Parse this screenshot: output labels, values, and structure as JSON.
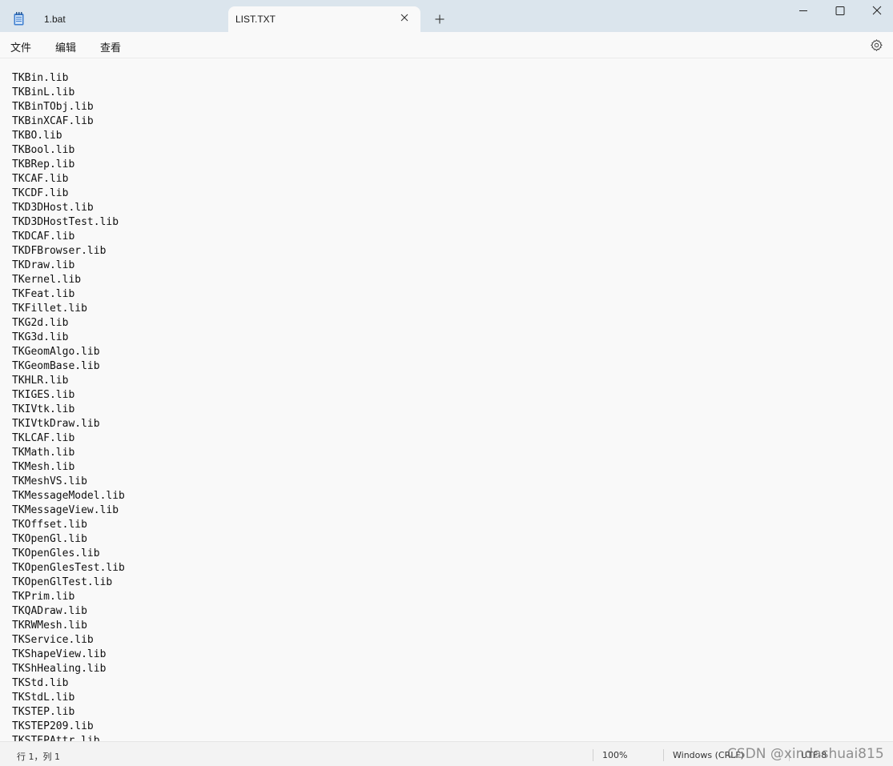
{
  "app": {
    "icon": "notepad-icon"
  },
  "tabs": [
    {
      "label": "1.bat",
      "active": false
    },
    {
      "label": "LIST.TXT",
      "active": true
    }
  ],
  "window_controls": {
    "minimize": "minimize-icon",
    "maximize": "maximize-icon",
    "close": "close-icon"
  },
  "menu": {
    "file": "文件",
    "edit": "编辑",
    "view": "查看",
    "settings_icon": "gear-icon"
  },
  "editor": {
    "lines": [
      "TKBin.lib",
      "TKBinL.lib",
      "TKBinTObj.lib",
      "TKBinXCAF.lib",
      "TKBO.lib",
      "TKBool.lib",
      "TKBRep.lib",
      "TKCAF.lib",
      "TKCDF.lib",
      "TKD3DHost.lib",
      "TKD3DHostTest.lib",
      "TKDCAF.lib",
      "TKDFBrowser.lib",
      "TKDraw.lib",
      "TKernel.lib",
      "TKFeat.lib",
      "TKFillet.lib",
      "TKG2d.lib",
      "TKG3d.lib",
      "TKGeomAlgo.lib",
      "TKGeomBase.lib",
      "TKHLR.lib",
      "TKIGES.lib",
      "TKIVtk.lib",
      "TKIVtkDraw.lib",
      "TKLCAF.lib",
      "TKMath.lib",
      "TKMesh.lib",
      "TKMeshVS.lib",
      "TKMessageModel.lib",
      "TKMessageView.lib",
      "TKOffset.lib",
      "TKOpenGl.lib",
      "TKOpenGles.lib",
      "TKOpenGlesTest.lib",
      "TKOpenGlTest.lib",
      "TKPrim.lib",
      "TKQADraw.lib",
      "TKRWMesh.lib",
      "TKService.lib",
      "TKShapeView.lib",
      "TKShHealing.lib",
      "TKStd.lib",
      "TKStdL.lib",
      "TKSTEP.lib",
      "TKSTEP209.lib",
      "TKSTEPAttr.lib"
    ]
  },
  "status": {
    "position": "行 1，列 1",
    "zoom": "100%",
    "line_ending": "Windows (CRLF)",
    "encoding": "UTF-8"
  },
  "watermark": "CSDN @xindashuai815"
}
